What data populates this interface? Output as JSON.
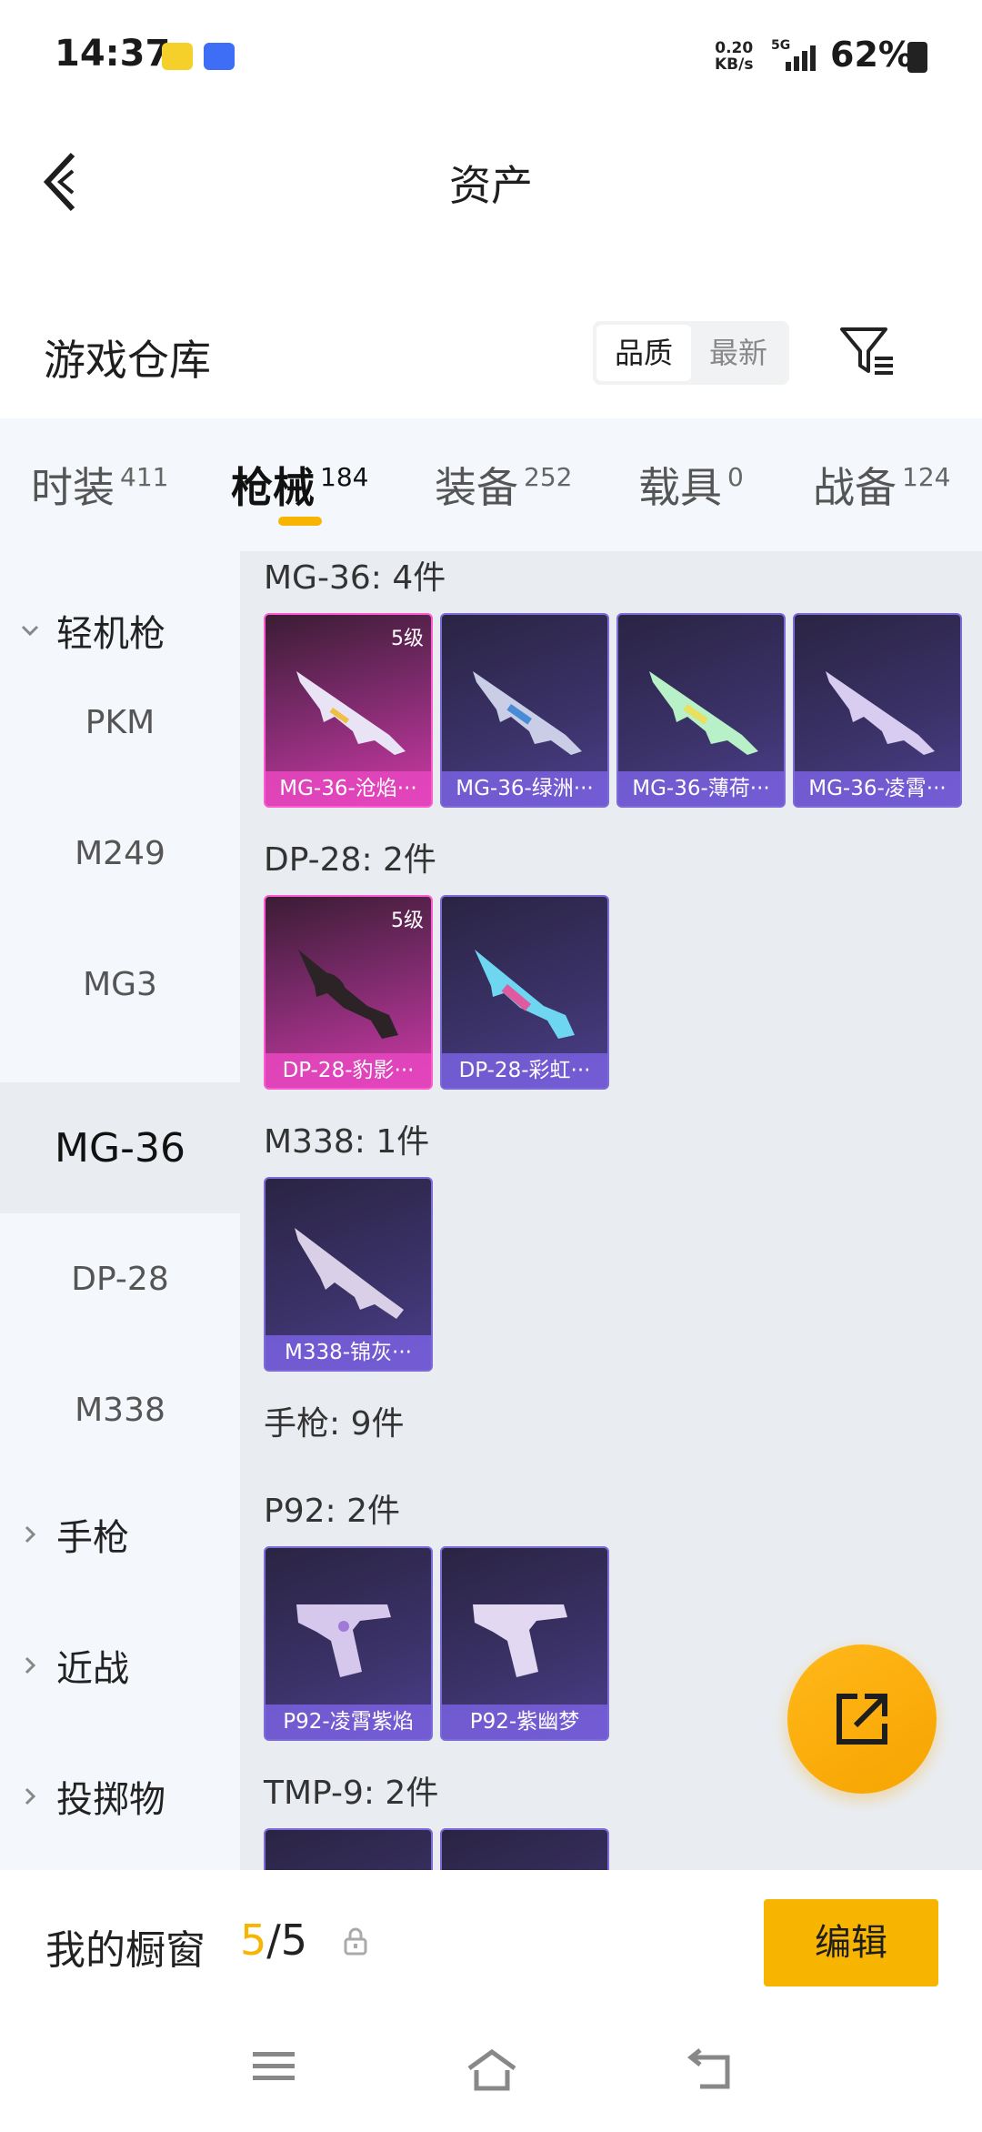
{
  "status_bar": {
    "time": "14:37",
    "net_speed_value": "0.20",
    "net_speed_unit": "KB/s",
    "network": "5G",
    "battery": "62%"
  },
  "header": {
    "title": "资产"
  },
  "warehouse": {
    "title": "游戏仓库",
    "sort_options": [
      "品质",
      "最新"
    ],
    "active_sort": "品质"
  },
  "tabs": [
    {
      "label": "时装",
      "count": "411"
    },
    {
      "label": "枪械",
      "count": "184"
    },
    {
      "label": "装备",
      "count": "252"
    },
    {
      "label": "载具",
      "count": "0"
    },
    {
      "label": "战备",
      "count": "124"
    }
  ],
  "active_tab": "枪械",
  "sidebar": {
    "group_open": "轻机枪",
    "items": [
      "PKM",
      "M249",
      "MG3",
      "MG-36",
      "DP-28",
      "M338"
    ],
    "active_item": "MG-36",
    "groups_closed": [
      "手枪",
      "近战",
      "投掷物"
    ]
  },
  "content": {
    "sections": [
      {
        "title": "MG-36: 4件",
        "cards": [
          {
            "name": "MG-36-沧焰···",
            "level": "5级",
            "rarity": "gold"
          },
          {
            "name": "MG-36-绿洲···",
            "level": "",
            "rarity": "purple"
          },
          {
            "name": "MG-36-薄荷···",
            "level": "",
            "rarity": "purple"
          },
          {
            "name": "MG-36-凌霄···",
            "level": "",
            "rarity": "purple"
          }
        ]
      },
      {
        "title": "DP-28: 2件",
        "cards": [
          {
            "name": "DP-28-豹影···",
            "level": "5级",
            "rarity": "gold"
          },
          {
            "name": "DP-28-彩虹···",
            "level": "",
            "rarity": "purple"
          }
        ]
      },
      {
        "title": "M338: 1件",
        "cards": [
          {
            "name": "M338-锦灰···",
            "level": "",
            "rarity": "purple"
          }
        ]
      },
      {
        "title": "手枪: 9件",
        "cards": []
      },
      {
        "title": "P92: 2件",
        "cards": [
          {
            "name": "P92-凌霄紫焰",
            "level": "",
            "rarity": "purple"
          },
          {
            "name": "P92-紫幽梦",
            "level": "",
            "rarity": "purple"
          }
        ]
      },
      {
        "title": "TMP-9: 2件",
        "cards": []
      }
    ]
  },
  "showcase": {
    "label": "我的橱窗",
    "current": "5",
    "separator": "/",
    "total": "5",
    "edit_label": "编辑"
  },
  "colors": {
    "accent": "#f7b400",
    "gold_card": "#d03aa8",
    "purple_card": "#4c3f8b",
    "tab_bg": "#f4f7fb"
  },
  "icons": [
    "back-icon",
    "filter-icon",
    "share-icon",
    "lock-icon",
    "menu-icon",
    "home-icon",
    "return-icon"
  ]
}
